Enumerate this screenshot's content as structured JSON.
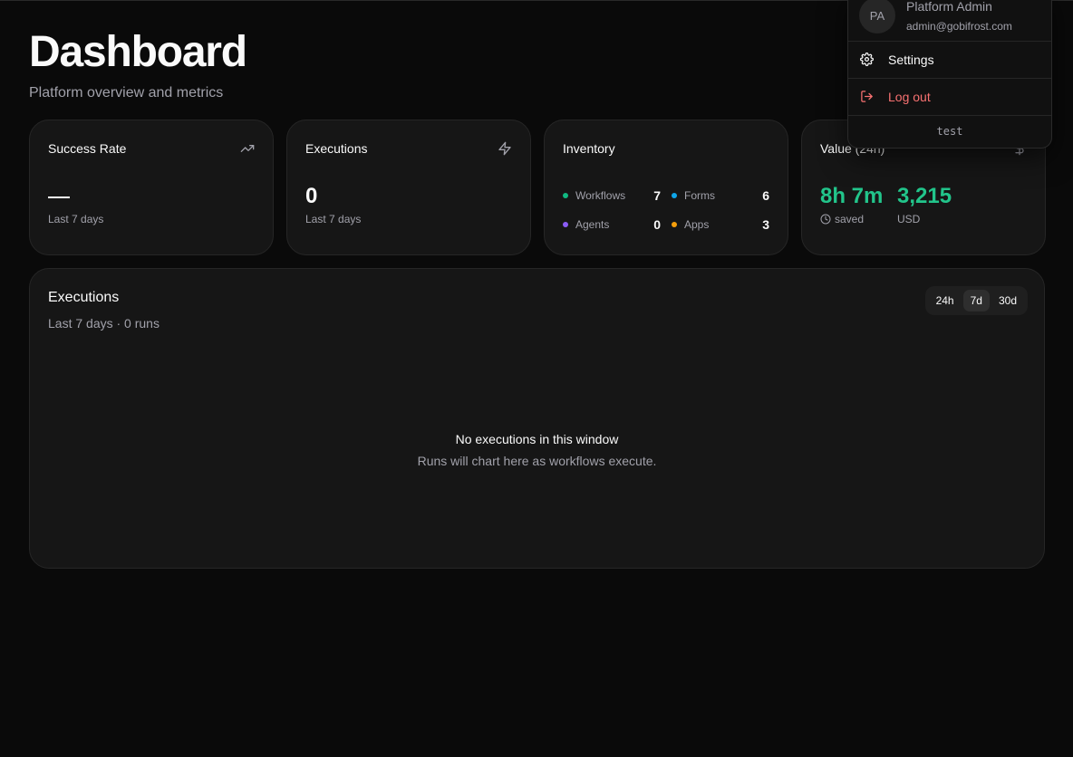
{
  "header": {
    "title": "Dashboard",
    "subtitle": "Platform overview and metrics"
  },
  "cards": {
    "success_rate": {
      "title": "Success Rate",
      "value": "—",
      "caption": "Last 7 days",
      "icon": "trending-up-icon"
    },
    "executions": {
      "title": "Executions",
      "value": "0",
      "caption": "Last 7 days",
      "icon": "zap-icon"
    },
    "inventory": {
      "title": "Inventory",
      "items": [
        {
          "label": "Workflows",
          "count": "7",
          "color": "#10b981"
        },
        {
          "label": "Forms",
          "count": "6",
          "color": "#0ea5e9"
        },
        {
          "label": "Agents",
          "count": "0",
          "color": "#8b5cf6"
        },
        {
          "label": "Apps",
          "count": "3",
          "color": "#f59e0b"
        }
      ]
    },
    "value": {
      "title": "Value (24h)",
      "icon": "dollar-icon",
      "time_saved": "8h 7m",
      "time_caption": "saved",
      "amount": "3,215",
      "amount_caption": "USD",
      "accent": "#22c58b"
    }
  },
  "executions_panel": {
    "title": "Executions",
    "subtitle": "Last 7 days · 0 runs",
    "ranges": [
      "24h",
      "7d",
      "30d"
    ],
    "selected_range": "7d",
    "empty_title": "No executions in this window",
    "empty_subtitle": "Runs will chart here as workflows execute."
  },
  "user_menu": {
    "initials": "PA",
    "name": "Platform Admin",
    "email": "admin@gobifrost.com",
    "settings_label": "Settings",
    "logout_label": "Log out",
    "logout_color": "#f87171",
    "footer": "test"
  }
}
